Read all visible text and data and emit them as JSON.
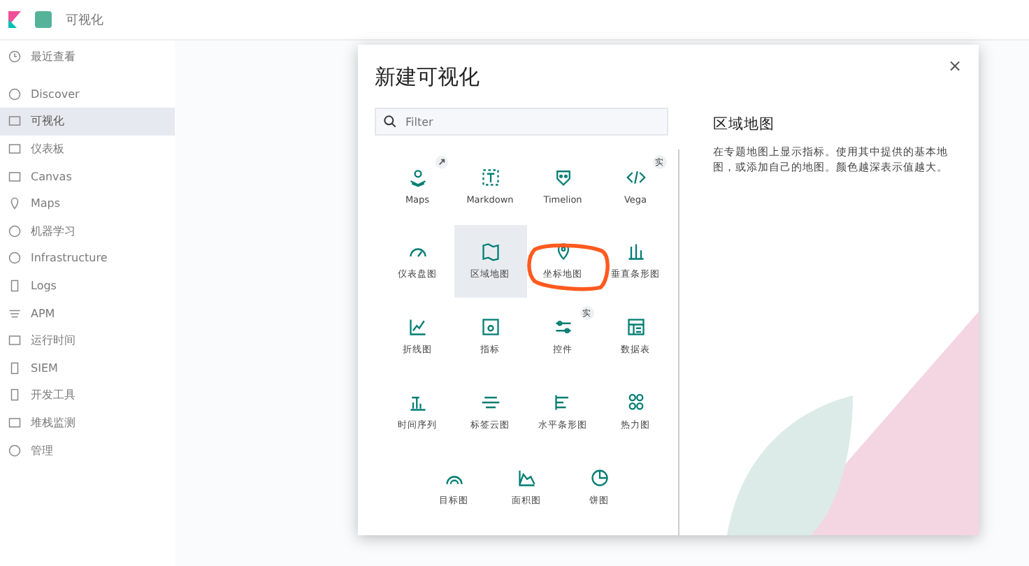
{
  "header": {
    "breadcrumb": "可视化"
  },
  "sidebar": {
    "recent": "最近查看",
    "items": [
      {
        "label": "Discover",
        "selected": false
      },
      {
        "label": "可视化",
        "selected": true
      },
      {
        "label": "仪表板",
        "selected": false
      },
      {
        "label": "Canvas",
        "selected": false
      },
      {
        "label": "Maps",
        "selected": false
      },
      {
        "label": "机器学习",
        "selected": false
      },
      {
        "label": "Infrastructure",
        "selected": false
      },
      {
        "label": "Logs",
        "selected": false
      },
      {
        "label": "APM",
        "selected": false
      },
      {
        "label": "运行时间",
        "selected": false
      },
      {
        "label": "SIEM",
        "selected": false
      },
      {
        "label": "开发工具",
        "selected": false
      },
      {
        "label": "堆栈监测",
        "selected": false
      },
      {
        "label": "管理",
        "selected": false
      }
    ]
  },
  "modal": {
    "title": "新建可视化",
    "close": "×",
    "search": {
      "placeholder": "Filter"
    },
    "types": [
      {
        "label": "Maps",
        "kind": "map",
        "external_link": true,
        "selected": false
      },
      {
        "label": "Markdown",
        "kind": "markdown",
        "selected": false
      },
      {
        "label": "Timelion",
        "kind": "timelion",
        "selected": false
      },
      {
        "label": "Vega",
        "kind": "code",
        "badge": "实",
        "selected": false
      },
      {
        "label": "仪表盘图",
        "kind": "gauge",
        "selected": false
      },
      {
        "label": "区域地图",
        "kind": "region",
        "selected": true
      },
      {
        "label": "坐标地图",
        "kind": "pin",
        "selected": false
      },
      {
        "label": "垂直条形图",
        "kind": "vbar",
        "selected": false
      },
      {
        "label": "折线图",
        "kind": "line",
        "selected": false
      },
      {
        "label": "指标",
        "kind": "metric",
        "selected": false
      },
      {
        "label": "控件",
        "kind": "controls",
        "badge": "实",
        "selected": false
      },
      {
        "label": "数据表",
        "kind": "table",
        "selected": false
      },
      {
        "label": "时间序列",
        "kind": "tsvb",
        "selected": false
      },
      {
        "label": "标签云图",
        "kind": "cloud",
        "selected": false
      },
      {
        "label": "水平条形图",
        "kind": "hbar",
        "selected": false
      },
      {
        "label": "热力图",
        "kind": "heat",
        "selected": false
      },
      {
        "label": "目标图",
        "kind": "goal",
        "selected": false
      },
      {
        "label": "面积图",
        "kind": "area",
        "selected": false
      },
      {
        "label": "饼图",
        "kind": "pie",
        "selected": false
      }
    ],
    "description": {
      "title": "区域地图",
      "text": "在专题地图上显示指标。使用其中提供的基本地图，或添加自己的地图。颜色越深表示值越大。"
    }
  }
}
